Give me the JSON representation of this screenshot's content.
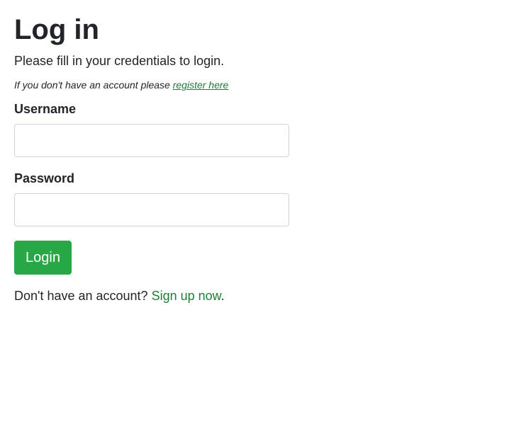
{
  "page": {
    "title": "Log in",
    "intro": "Please fill in your credentials to login.",
    "note_prefix": "If you don't have an account please ",
    "note_link": "register here"
  },
  "form": {
    "username_label": "Username",
    "username_value": "",
    "password_label": "Password",
    "password_value": "",
    "submit_label": "Login"
  },
  "footer": {
    "prefix": "Don't have an account? ",
    "link": "Sign up now",
    "suffix": "."
  },
  "colors": {
    "accent": "#28a745",
    "link": "#1e7e34",
    "text": "#212529"
  }
}
